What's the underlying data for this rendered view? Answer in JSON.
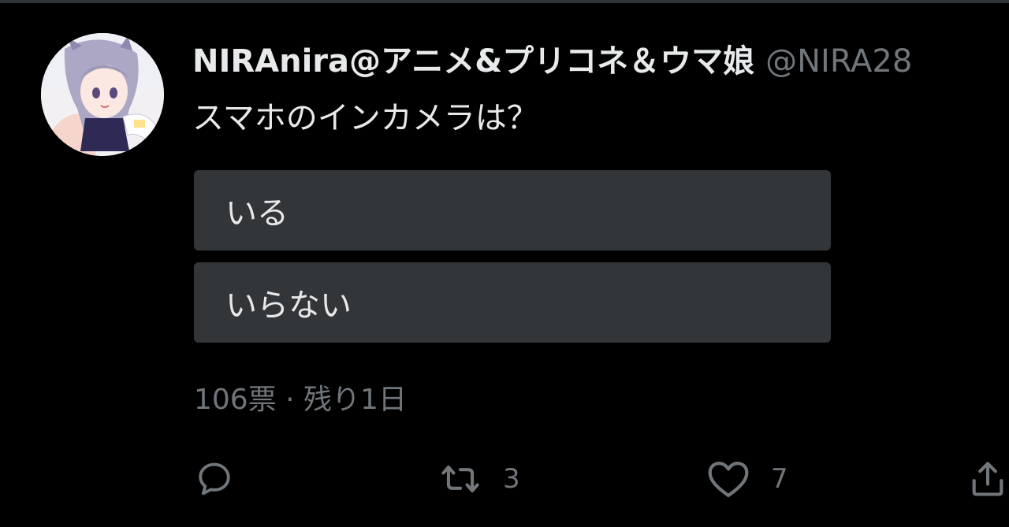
{
  "tweet": {
    "author": {
      "display_name": "NIRAnira@アニメ&プリコネ＆ウマ娘",
      "handle": "@NIRA28"
    },
    "text": "スマホのインカメラは？",
    "poll": {
      "options": [
        {
          "label": "いる"
        },
        {
          "label": "いらない"
        }
      ],
      "meta": "106票 · 残り1日"
    },
    "actions": {
      "reply_count": "",
      "retweet_count": "3",
      "like_count": "7"
    }
  },
  "colors": {
    "background": "#000000",
    "primary_text": "#e7e9ea",
    "secondary_text": "#71767b",
    "poll_option_bg": "#333639"
  },
  "icons": {
    "reply": "speech-bubble",
    "retweet": "retweet-arrows",
    "like": "heart-outline",
    "share": "share-upload"
  }
}
